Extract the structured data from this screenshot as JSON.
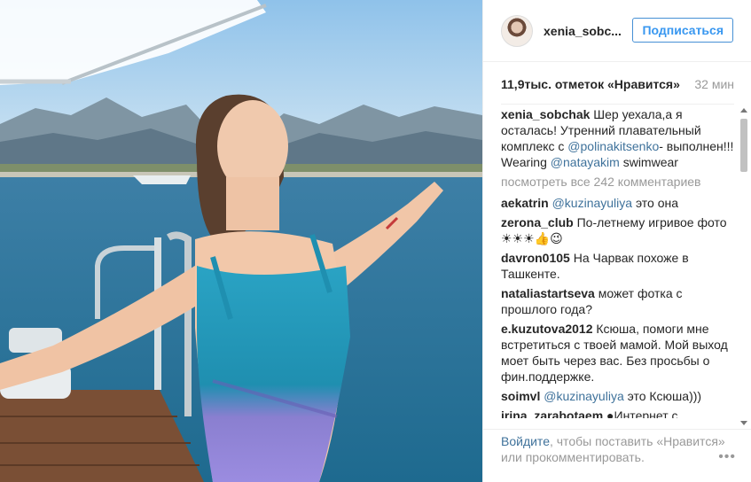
{
  "post": {
    "username": "xenia_sobc...",
    "follow_label": "Подписаться",
    "likes": "11,9тыс. отметок «Нравится»",
    "time": "32 мин"
  },
  "caption": {
    "user": "xenia_sobchak",
    "text1": " Шер уехала,а я осталась! Утренний плавательный комплекс с ",
    "mention1": "@polinakitsenko",
    "text2": "- выполнен!!! Wearing ",
    "mention2": "@natayakim",
    "text3": " swimwear"
  },
  "view_all": "посмотреть все 242 комментариев",
  "comments": [
    {
      "user": "aekatrin",
      "mention": "@kuzinayuliya",
      "text": " это она"
    },
    {
      "user": "zerona_club",
      "mention": "",
      "text": " По-летнему игривое фото ☀☀☀👍😉"
    },
    {
      "user": "davron0105",
      "mention": "",
      "text": " На Чарвак похоже в Ташкенте."
    },
    {
      "user": "nataliastartseva",
      "mention": "",
      "text": " может фотка с прошлого года?"
    },
    {
      "user": "e.kuzutova2012",
      "mention": "",
      "text": " Ксюша, помоги мне встретиться с твоей мамой. Мой выход моет быть через вас. Без просьбы о фин.поддержке."
    },
    {
      "user": "soimvl",
      "mention": "@kuzinayuliya",
      "text": " это Ксюша)))"
    },
    {
      "user": "irina_zarabotaem",
      "mention": "",
      "text": " ●Интернет с"
    }
  ],
  "footer": {
    "login": "Войдите",
    "text": ", чтобы поставить «Нравится» или прокомментировать.",
    "more": "•••"
  }
}
